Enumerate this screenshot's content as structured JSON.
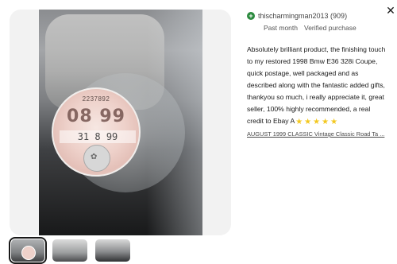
{
  "review": {
    "reviewer": "thischarmingman2013 (909)",
    "period": "Past month",
    "verified": "Verified purchase",
    "text": "Absolutely brilliant product, the finishing touch to my restored 1998 Bmw E36 328i Coupe, quick postage, well packaged and as described along with the fantastic added gifts, thankyou so much, i really appreciate it, great seller, 100% highly recommended, a real credit to Ebay A",
    "rating": 5,
    "item_link": "AUGUST 1999 CLASSIC Vintage Classic Road Ta ..."
  },
  "photo": {
    "disc_serial": "2237892",
    "disc_code": "08 99",
    "disc_date": "31 8 99"
  },
  "thumbnails": {
    "count": 3,
    "active_index": 0
  },
  "icons": {
    "verified": "plus-circle-icon",
    "close": "close-icon",
    "star": "star-icon"
  },
  "colors": {
    "star": "#f3c81f",
    "verified_badge": "#2b8a3e"
  }
}
